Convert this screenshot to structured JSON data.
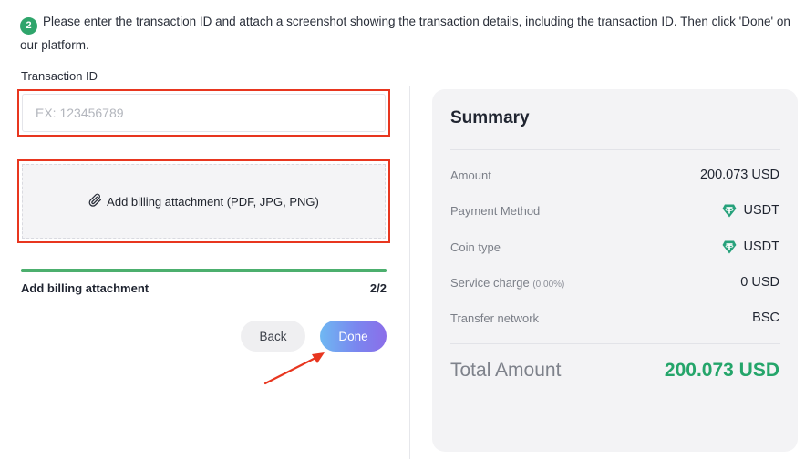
{
  "step": {
    "number": "2",
    "instruction": "Please enter the transaction ID and attach a screenshot showing the transaction details, including the transaction ID. Then click 'Done' on our platform."
  },
  "form": {
    "transaction_label": "Transaction ID",
    "transaction_value": "",
    "transaction_placeholder": "EX: 123456789",
    "attach_label": "Add billing attachment (PDF, JPG, PNG)"
  },
  "progress": {
    "label": "Add billing attachment",
    "count": "2/2",
    "fraction": 1.0
  },
  "buttons": {
    "back": "Back",
    "done": "Done"
  },
  "summary": {
    "title": "Summary",
    "rows": [
      {
        "key": "Amount",
        "value": "200.073 USD"
      },
      {
        "key": "Payment Method",
        "value": "USDT",
        "icon": "tether-icon"
      },
      {
        "key": "Coin type",
        "value": "USDT",
        "icon": "tether-icon"
      },
      {
        "key": "Service charge",
        "key_note": "(0.00%)",
        "value": "0 USD"
      },
      {
        "key": "Transfer network",
        "value": "BSC"
      }
    ],
    "total_label": "Total Amount",
    "total_value": "200.073 USD"
  },
  "colors": {
    "accent_green": "#2fa56b",
    "highlight_red": "#e8361f",
    "tether_green": "#26a17b",
    "total_green": "#24a56a"
  }
}
